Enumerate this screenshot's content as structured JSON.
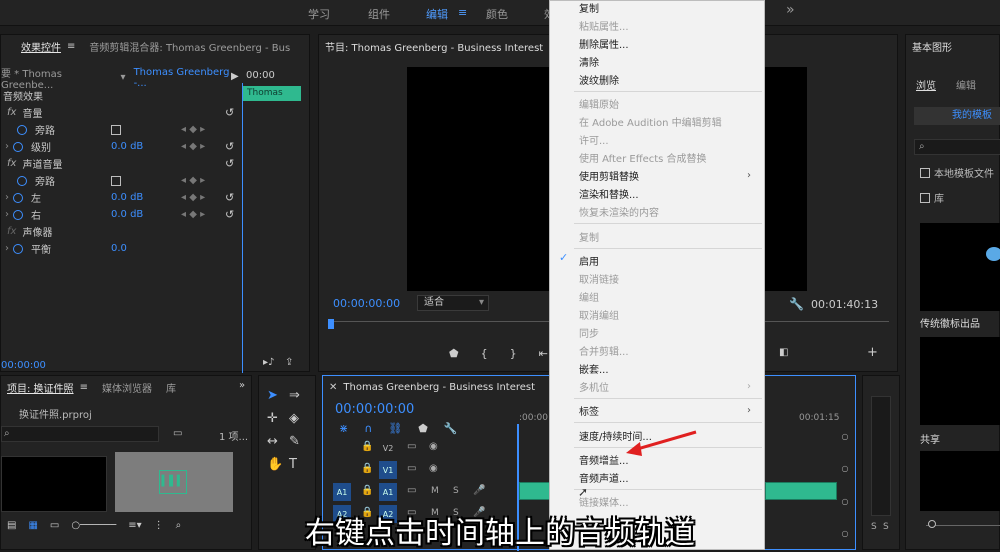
{
  "topbar": {
    "tabs": [
      "学习",
      "组件",
      "编辑",
      "颜色",
      "效"
    ],
    "active_tab": "编辑",
    "more": "»"
  },
  "effects_panel": {
    "tabs": [
      "效果控件",
      "音频剪辑混合器: Thomas Greenberg - Bus"
    ],
    "source_label": "要 * Thomas Greenbe...",
    "clip_label": "Thomas Greenberg -...",
    "time_ruler": "00:00",
    "clip_name": "Thomas Gree",
    "section": "音频效果",
    "fx_volume": "音量",
    "bypass": "旁路",
    "level": "级别",
    "level_value": "0.0 dB",
    "fx_channel": "声道音量",
    "bypass2": "旁路",
    "left": "左",
    "left_value": "0.0 dB",
    "right": "右",
    "right_value": "0.0 dB",
    "panner": "声像器",
    "balance": "平衡",
    "balance_value": "0.0",
    "timecode": "00:00:00"
  },
  "program": {
    "title": "节目: Thomas Greenberg - Business Interest",
    "timecode": "00:00:00:00",
    "fit": "适合",
    "duration": "00:01:40:13"
  },
  "project": {
    "tabs": [
      "项目: 换证件照",
      "媒体浏览器",
      "库"
    ],
    "file": "换证件照.prproj",
    "count": "1 项..."
  },
  "timeline": {
    "title": "Thomas Greenberg - Business Interest",
    "timecode": "00:00:00:00",
    "ruler_left": ":00:00",
    "ruler_right": "00:01:15",
    "tracks": [
      "V2",
      "V1",
      "A1",
      "A2"
    ],
    "m_label": "M",
    "s_label": "S"
  },
  "graphics": {
    "title": "基本图形",
    "tabs": [
      "浏览",
      "编辑"
    ],
    "my_templates": "我的模板",
    "local_templates": "本地模板文件",
    "library": "库",
    "item1": "传统徽标出品",
    "item2": "共享"
  },
  "context_menu": {
    "items": [
      {
        "label": "复制",
        "enabled": true
      },
      {
        "label": "粘贴属性...",
        "enabled": false
      },
      {
        "label": "删除属性...",
        "enabled": true
      },
      {
        "label": "清除",
        "enabled": true
      },
      {
        "label": "波纹删除",
        "enabled": true
      },
      {
        "label": "编辑原始",
        "enabled": false
      },
      {
        "label": "在 Adobe Audition 中编辑剪辑",
        "enabled": false
      },
      {
        "label": "许可...",
        "enabled": false
      },
      {
        "label": "使用 After Effects 合成替换",
        "enabled": false
      },
      {
        "label": "使用剪辑替换",
        "enabled": true,
        "submenu": true
      },
      {
        "label": "渲染和替换...",
        "enabled": true
      },
      {
        "label": "恢复未渲染的内容",
        "enabled": false
      },
      {
        "label": "复制",
        "enabled": false
      },
      {
        "label": "启用",
        "enabled": true,
        "checked": true
      },
      {
        "label": "取消链接",
        "enabled": false
      },
      {
        "label": "编组",
        "enabled": false
      },
      {
        "label": "取消编组",
        "enabled": false
      },
      {
        "label": "同步",
        "enabled": false
      },
      {
        "label": "合并剪辑...",
        "enabled": false
      },
      {
        "label": "嵌套...",
        "enabled": true
      },
      {
        "label": "多机位",
        "enabled": false,
        "submenu": true
      },
      {
        "label": "标签",
        "enabled": true,
        "submenu": true
      },
      {
        "label": "速度/持续时间...",
        "enabled": true
      },
      {
        "label": "音频增益...",
        "enabled": true
      },
      {
        "label": "音频声道...",
        "enabled": true
      },
      {
        "label": "链接媒体...",
        "enabled": false
      }
    ]
  },
  "caption": "右键点击时间轴上的音频轨道",
  "colors": {
    "accent": "#3d8fff",
    "clip_green": "#2fb98f",
    "arrow_red": "#e02020"
  }
}
